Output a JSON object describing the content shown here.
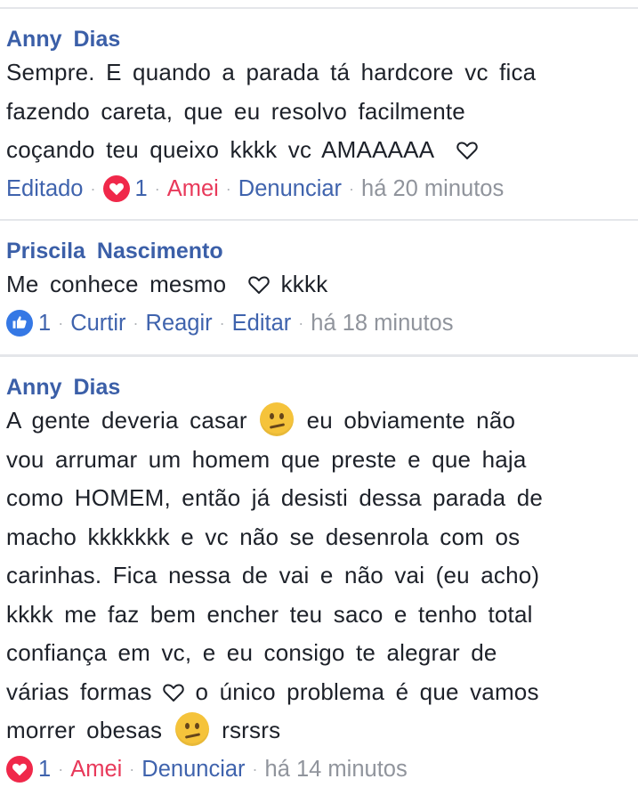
{
  "colors": {
    "author": "#3b5fa8",
    "link": "#3f63ad",
    "love": "#e8395a",
    "muted": "#90949c",
    "emoji": "#f5c33b",
    "like_blue": "#3578e5"
  },
  "comments": [
    {
      "author": "Anny Dias",
      "lines": [
        "Sempre. E quando a parada tá hardcore vc fica",
        "fazendo careta, que eu resolvo facilmente",
        "coçando teu queixo kkkk vc AMAAAAA"
      ],
      "actions": {
        "edited": "Editado",
        "reaction_icon": "heart-icon",
        "reaction_count": "1",
        "reaction_label": "Amei",
        "report": "Denunciar",
        "time": "há 20 minutos"
      }
    },
    {
      "author": "Priscila Nascimento",
      "lines": [
        "Me conhece mesmo",
        "kkkk"
      ],
      "actions": {
        "reaction_icon": "like-icon",
        "reaction_count": "1",
        "like": "Curtir",
        "react": "Reagir",
        "edit": "Editar",
        "time": "há 18 minutos"
      }
    },
    {
      "author": "Anny Dias",
      "lines": [
        "A gente deveria casar",
        "eu obviamente não",
        "vou arrumar um homem que preste e que haja",
        "como HOMEM, então já desisti dessa parada de",
        "macho kkkkkkk e vc não se desenrola com os",
        "carinhas. Fica nessa de vai e não vai (eu acho)",
        "kkkk me faz bem encher teu saco e tenho total",
        "confiança em vc, e eu consigo te alegrar de",
        "várias formas",
        "o único problema é que vamos",
        "morrer obesas",
        "rsrsrs"
      ],
      "actions": {
        "reaction_icon": "heart-icon",
        "reaction_count": "1",
        "reaction_label": "Amei",
        "report": "Denunciar",
        "time": "há 14 minutos"
      }
    }
  ]
}
